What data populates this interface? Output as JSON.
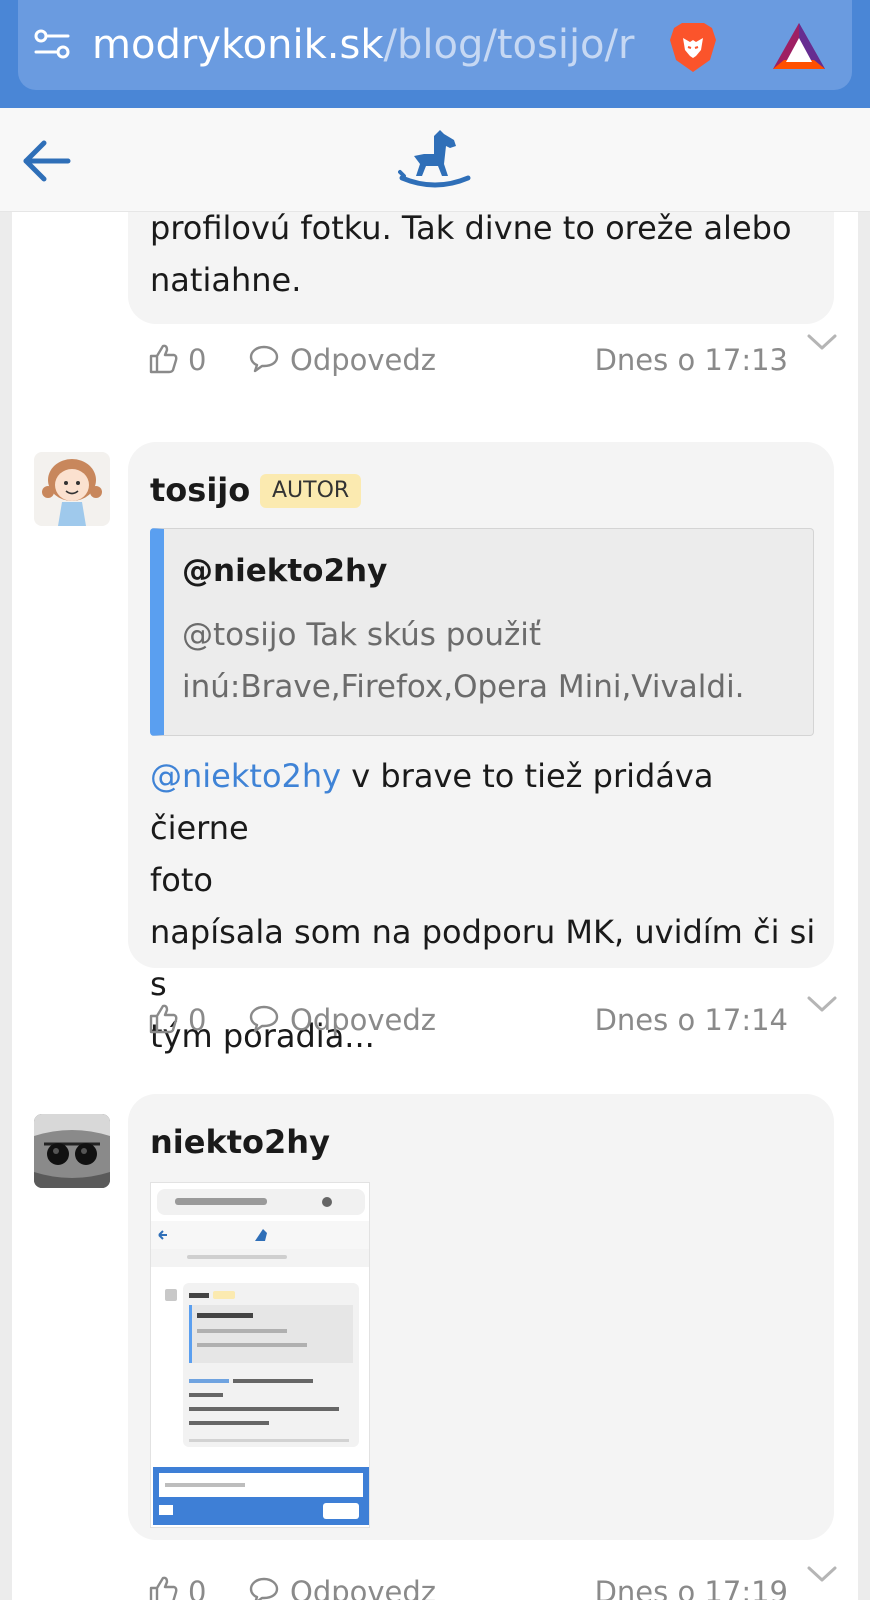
{
  "browser": {
    "url_host": "modrykonik.sk",
    "url_path": "/blog/tosijo/r",
    "icons": [
      "tune-icon",
      "brave-lion-icon",
      "bat-rewards-icon"
    ],
    "bar_color": "#4a86d6"
  },
  "header": {
    "icons": [
      "back-arrow-icon",
      "rocking-horse-logo-icon"
    ],
    "accent_color": "#2f6fb8"
  },
  "comments": [
    {
      "text_lines": [
        "profilovú fotku. Tak divne to oreže alebo",
        "natiahne."
      ],
      "likes": "0",
      "reply_label": "Odpovedz",
      "timestamp": "Dnes o 17:13"
    },
    {
      "author": "tosijo",
      "badge": "AUTOR",
      "quote": {
        "author": "@niekto2hy",
        "lines": [
          "@tosijo Tak skús použiť",
          "inú:Brave,Firefox,Opera Mini,Vivaldi."
        ]
      },
      "mention": "@niekto2hy",
      "text_first": " v brave to tiež pridáva čierne",
      "text_lines": [
        "foto",
        "napísala som na podporu MK, uvidím či si s",
        "tým poradia..."
      ],
      "likes": "0",
      "reply_label": "Odpovedz",
      "timestamp": "Dnes o 17:14"
    },
    {
      "author": "niekto2hy",
      "attachment": "screenshot-thumbnail",
      "likes": "0",
      "reply_label": "Odpovedz",
      "timestamp": "Dnes o 17:19"
    }
  ]
}
